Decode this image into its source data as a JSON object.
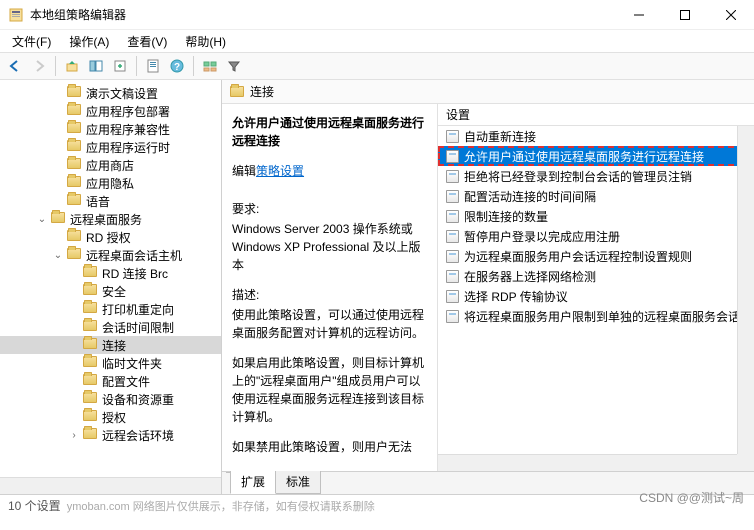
{
  "window": {
    "title": "本地组策略编辑器"
  },
  "menu": {
    "file": "文件(F)",
    "action": "操作(A)",
    "view": "查看(V)",
    "help": "帮助(H)"
  },
  "tree": {
    "items": [
      {
        "indent": 3,
        "label": "演示文稿设置",
        "expand": ""
      },
      {
        "indent": 3,
        "label": "应用程序包部署",
        "expand": ""
      },
      {
        "indent": 3,
        "label": "应用程序兼容性",
        "expand": ""
      },
      {
        "indent": 3,
        "label": "应用程序运行时",
        "expand": ""
      },
      {
        "indent": 3,
        "label": "应用商店",
        "expand": ""
      },
      {
        "indent": 3,
        "label": "应用隐私",
        "expand": ""
      },
      {
        "indent": 3,
        "label": "语音",
        "expand": ""
      },
      {
        "indent": 2,
        "label": "远程桌面服务",
        "expand": "v"
      },
      {
        "indent": 3,
        "label": "RD 授权",
        "expand": ""
      },
      {
        "indent": 3,
        "label": "远程桌面会话主机",
        "expand": "v"
      },
      {
        "indent": 4,
        "label": "RD 连接 Brc",
        "expand": ""
      },
      {
        "indent": 4,
        "label": "安全",
        "expand": ""
      },
      {
        "indent": 4,
        "label": "打印机重定向",
        "expand": ""
      },
      {
        "indent": 4,
        "label": "会话时间限制",
        "expand": ""
      },
      {
        "indent": 4,
        "label": "连接",
        "expand": "",
        "selected": true
      },
      {
        "indent": 4,
        "label": "临时文件夹",
        "expand": ""
      },
      {
        "indent": 4,
        "label": "配置文件",
        "expand": ""
      },
      {
        "indent": 4,
        "label": "设备和资源重",
        "expand": ""
      },
      {
        "indent": 4,
        "label": "授权",
        "expand": ""
      },
      {
        "indent": 4,
        "label": "远程会话环境",
        "expand": ">"
      }
    ]
  },
  "detail": {
    "header": "连接",
    "selected_title": "允许用户通过使用远程桌面服务进行远程连接",
    "edit_label": "编辑",
    "edit_link": "策略设置",
    "req_label": "要求:",
    "req_text": "Windows Server 2003 操作系统或 Windows XP Professional 及以上版本",
    "desc_label": "描述:",
    "desc_para1": "使用此策略设置，可以通过使用远程桌面服务配置对计算机的远程访问。",
    "desc_para2": "如果启用此策略设置，则目标计算机上的\"远程桌面用户\"组成员用户可以使用远程桌面服务远程连接到该目标计算机。",
    "desc_para3": "如果禁用此策略设置，则用户无法"
  },
  "list": {
    "header": "设置",
    "items": [
      "自动重新连接",
      "允许用户通过使用远程桌面服务进行远程连接",
      "拒绝将已经登录到控制台会话的管理员注销",
      "配置活动连接的时间间隔",
      "限制连接的数量",
      "暂停用户登录以完成应用注册",
      "为远程桌面服务用户会话远程控制设置规则",
      "在服务器上选择网络检测",
      "选择 RDP 传输协议",
      "将远程桌面服务用户限制到单独的远程桌面服务会话"
    ],
    "selected_index": 1
  },
  "tabs": {
    "extended": "扩展",
    "standard": "标准"
  },
  "statusbar": {
    "count": "10 个设置",
    "watermark_left": "ymoban.com    网络图片仅供展示，非存储，如有侵权请联系删除",
    "watermark_right": "CSDN @@测试~周"
  }
}
